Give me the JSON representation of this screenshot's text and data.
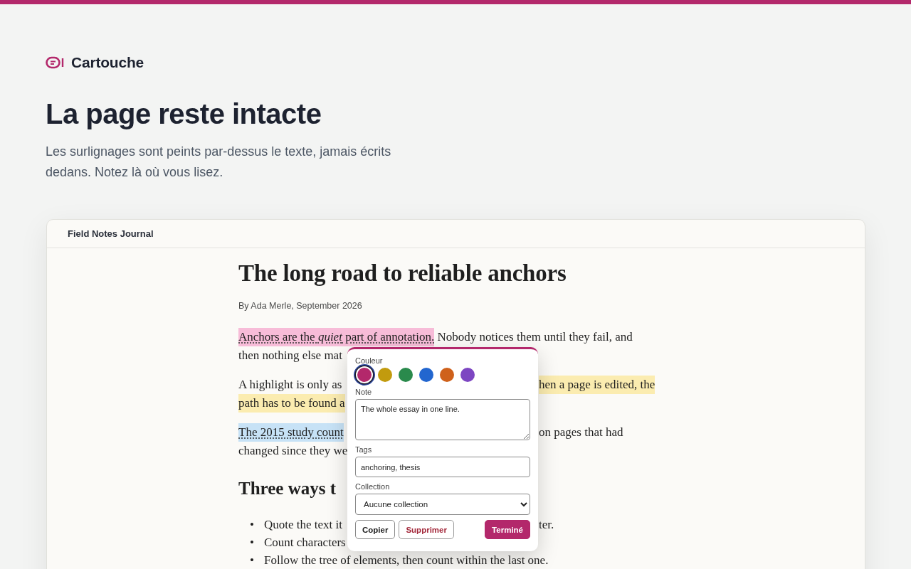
{
  "brand": {
    "name": "Cartouche"
  },
  "hero": {
    "title": "La page reste intacte",
    "subtitle": "Les surlignages sont peints par-dessus le texte, jamais écrits dedans. Notez là où vous lisez."
  },
  "card": {
    "title": "Field Notes Journal"
  },
  "article": {
    "title": "The long road to reliable anchors",
    "byline": "By Ada Merle, September 2026",
    "paragraphs": [
      {
        "lines": [
          {
            "left": [
              {
                "text": "Anchors are the *quiet* part of annotation.",
                "color": "#f7bcd8",
                "noted": true
              },
              {
                "text": " Nobody notices them until they fail, and"
              }
            ]
          },
          {
            "left": [
              {
                "text": "then nothing else mat"
              }
            ]
          }
        ]
      },
      {
        "lines": [
          {
            "left": [
              {
                "text": "A highlight is only as"
              }
            ],
            "right": [
              {
                "text": "hen a page is edited, the",
                "color": "#fbecb0",
                "noted": false
              }
            ]
          },
          {
            "left": [
              {
                "text": "path has to be found a",
                "color": "#fbecb0",
                "noted": false
              }
            ]
          }
        ]
      },
      {
        "lines": [
          {
            "left": [
              {
                "text": "The 2015 study count",
                "color": "#c7e2f6",
                "noted": true
              }
            ],
            "right": [
              {
                "text": "on pages that had"
              }
            ]
          },
          {
            "left": [
              {
                "text": "changed since they we"
              }
            ]
          }
        ]
      }
    ],
    "heading": "Three ways t",
    "list": [
      {
        "marker": "•",
        "left": "Quote the text it",
        "right": "ter."
      },
      {
        "marker": "•",
        "left": "Count characters"
      },
      {
        "marker": "•",
        "left": "Follow the tree of elements, then count within the last one."
      }
    ]
  },
  "popover": {
    "color_label": "Couleur",
    "swatches": [
      {
        "color": "#b3286b",
        "selected": true
      },
      {
        "color": "#c29b0e",
        "selected": false
      },
      {
        "color": "#2a8a4c",
        "selected": false
      },
      {
        "color": "#2266cf",
        "selected": false
      },
      {
        "color": "#cf611b",
        "selected": false
      },
      {
        "color": "#7d46c2",
        "selected": false
      }
    ],
    "note_label": "Note",
    "note": "The whole essay in one line.",
    "tags_label": "Tags",
    "tags": "anchoring, thesis",
    "collection_label": "Collection",
    "collection": "Aucune collection",
    "buttons": [
      {
        "label": "Copier",
        "kind": "secondary"
      },
      {
        "label": "Supprimer",
        "kind": "danger"
      },
      {
        "label": "Terminé",
        "kind": "primary"
      }
    ]
  }
}
